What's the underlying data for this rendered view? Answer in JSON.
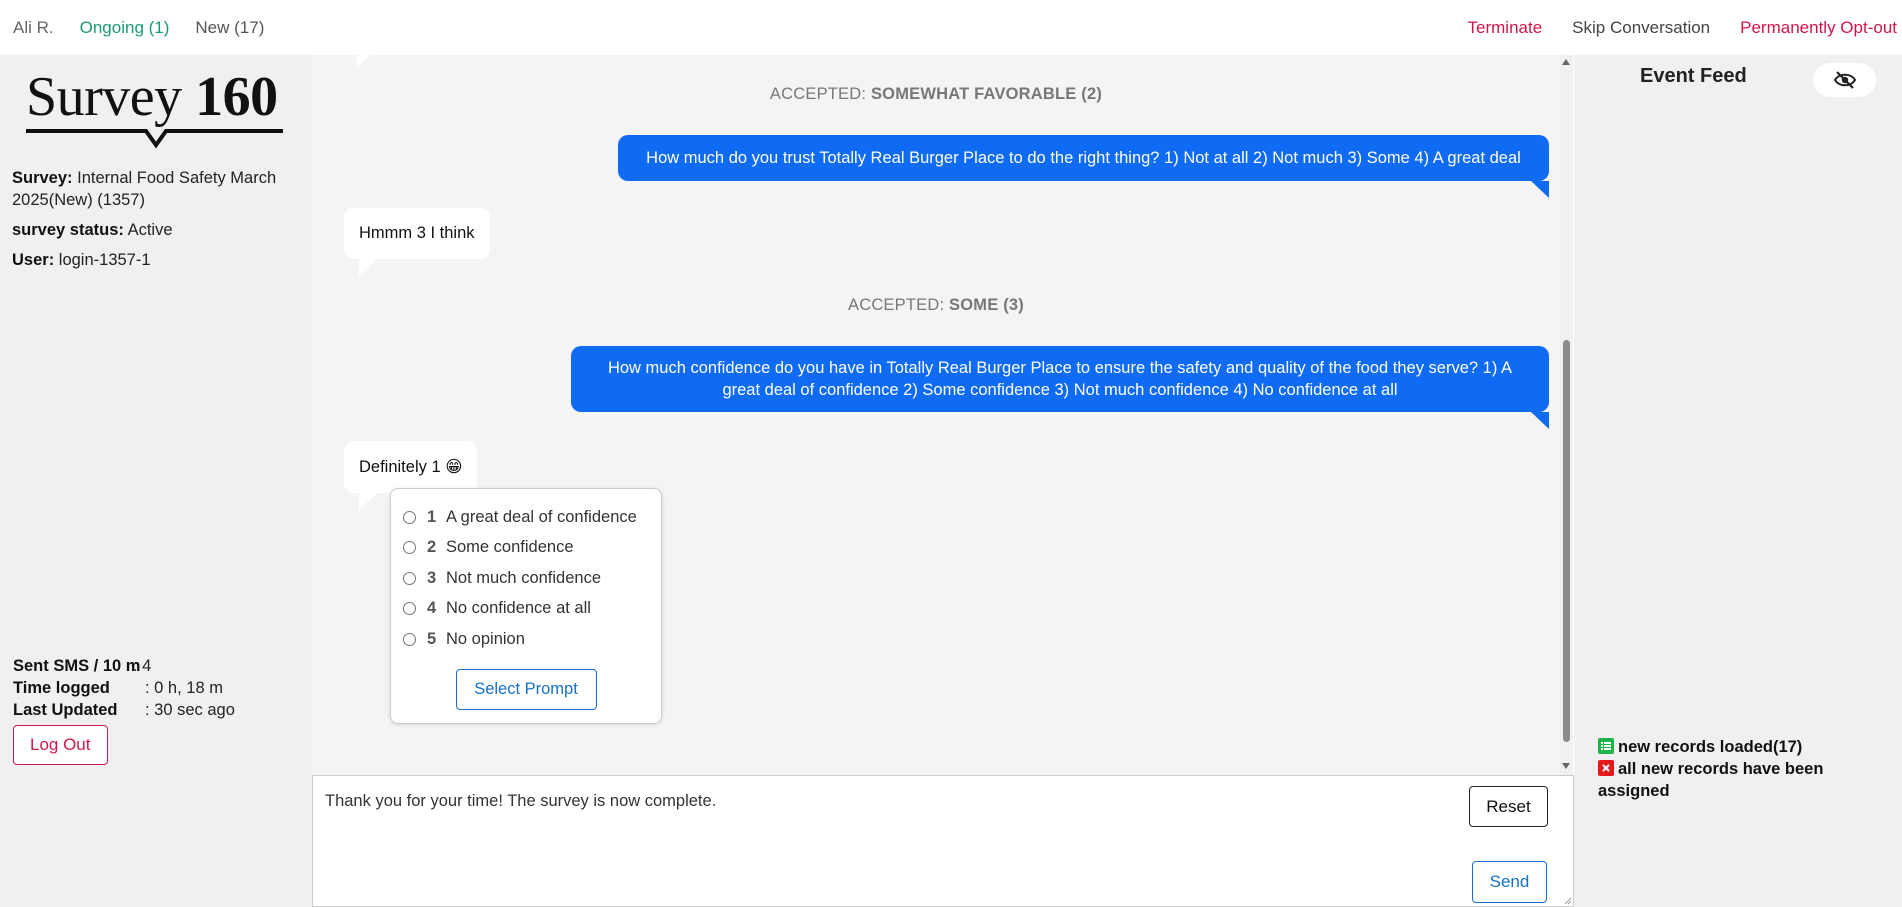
{
  "topbar": {
    "user": "Ali R.",
    "ongoing": "Ongoing (1)",
    "new": "New (17)",
    "terminate": "Terminate",
    "skip": "Skip Conversation",
    "optout": "Permanently Opt-out"
  },
  "sidebar": {
    "logo_text_light": "Survey",
    "logo_text_bold": "160",
    "survey_label": "Survey:",
    "survey_value": "Internal Food Safety March 2025(New) (1357)",
    "status_label": "survey status:",
    "status_value": "Active",
    "user_label": "User:",
    "user_value": "login-1357-1",
    "stats": [
      {
        "key": "Sent SMS / 10 m",
        "value": ": 4"
      },
      {
        "key": "Time logged",
        "value": ": 0 h, 18 m"
      },
      {
        "key": "Last Updated",
        "value": ": 30 sec ago"
      }
    ],
    "logout": "Log Out"
  },
  "chat": {
    "accepted_1_prefix": "ACCEPTED:",
    "accepted_1_value": "SOMEWHAT FAVORABLE (2)",
    "question_1": "How much do you trust Totally Real Burger Place to do the right thing? 1) Not at all 2) Not much 3) Some 4) A great deal",
    "reply_1": "Hmmm 3 I think",
    "accepted_2_prefix": "ACCEPTED:",
    "accepted_2_value": "SOME (3)",
    "question_2": "How much confidence do you have in Totally Real Burger Place to ensure the safety and quality of the food they serve? 1) A great deal of confidence 2) Some confidence 3) Not much confidence 4) No confidence at all",
    "reply_2": "Definitely 1 😁",
    "options": [
      {
        "num": "1",
        "label": "A great deal of confidence"
      },
      {
        "num": "2",
        "label": "Some confidence"
      },
      {
        "num": "3",
        "label": "Not much confidence"
      },
      {
        "num": "4",
        "label": "No confidence at all"
      },
      {
        "num": "5",
        "label": "No opinion"
      }
    ],
    "select_prompt": "Select Prompt"
  },
  "compose": {
    "text": "Thank you for your time! The survey is now complete.",
    "reset": "Reset",
    "send": "Send"
  },
  "feed": {
    "title": "Event Feed",
    "items": [
      {
        "icon": "list-icon",
        "text": "new records loaded(17)"
      },
      {
        "icon": "error-icon",
        "text": "all new records have been assigned"
      }
    ]
  },
  "colors": {
    "outgoing_bubble": "#0f6bf4",
    "danger": "#d0174a",
    "ongoing": "#1a9c6b",
    "button_blue": "#1672c4"
  }
}
